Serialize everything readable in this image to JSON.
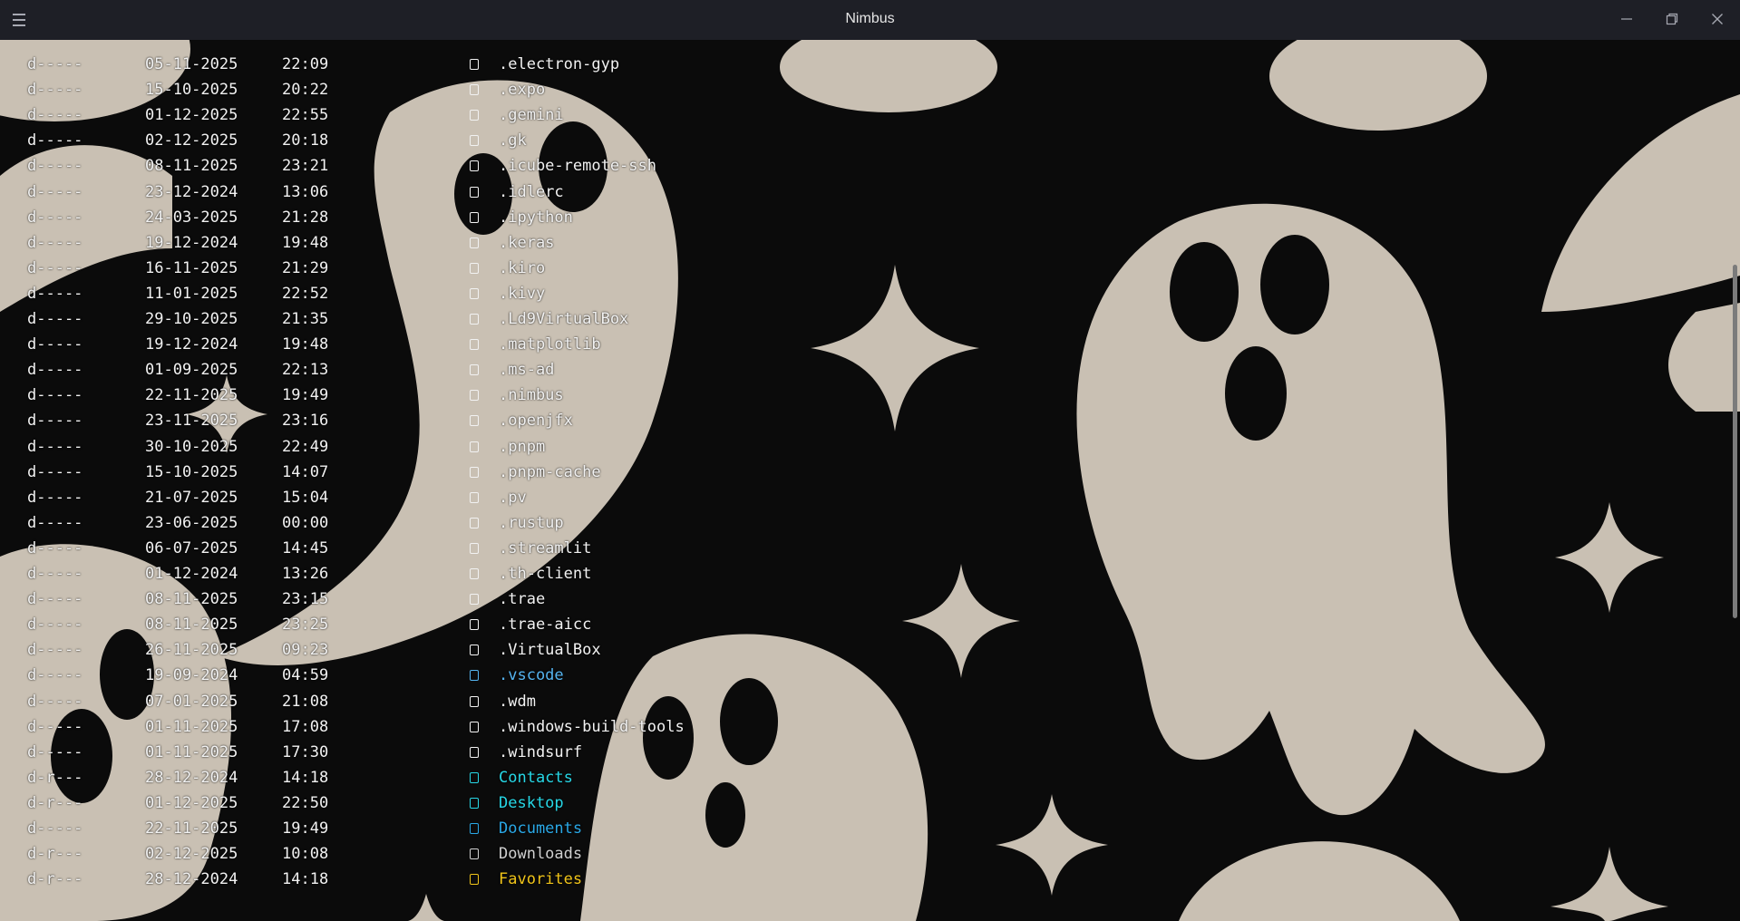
{
  "window": {
    "title": "Nimbus"
  },
  "colors": {
    "default": "#f2f2f2",
    "cyan": "#27d7e6",
    "blue": "#55b4f0",
    "docblue": "#2aa8e6",
    "gray": "#d0d0d0",
    "yellow": "#f0c419",
    "ghost": "#c9c0b3",
    "background": "#0b0b0b"
  },
  "entries": [
    {
      "mode": "d-----",
      "date": "05-11-2025",
      "time": "22:09",
      "name": ".electron-gyp",
      "color": "default"
    },
    {
      "mode": "d-----",
      "date": "15-10-2025",
      "time": "20:22",
      "name": ".expo",
      "color": "default"
    },
    {
      "mode": "d-----",
      "date": "01-12-2025",
      "time": "22:55",
      "name": ".gemini",
      "color": "default"
    },
    {
      "mode": "d-----",
      "date": "02-12-2025",
      "time": "20:18",
      "name": ".gk",
      "color": "default"
    },
    {
      "mode": "d-----",
      "date": "08-11-2025",
      "time": "23:21",
      "name": ".icube-remote-ssh",
      "color": "default"
    },
    {
      "mode": "d-----",
      "date": "23-12-2024",
      "time": "13:06",
      "name": ".idlerc",
      "color": "default"
    },
    {
      "mode": "d-----",
      "date": "24-03-2025",
      "time": "21:28",
      "name": ".ipython",
      "color": "default"
    },
    {
      "mode": "d-----",
      "date": "19-12-2024",
      "time": "19:48",
      "name": ".keras",
      "color": "default"
    },
    {
      "mode": "d-----",
      "date": "16-11-2025",
      "time": "21:29",
      "name": ".kiro",
      "color": "default"
    },
    {
      "mode": "d-----",
      "date": "11-01-2025",
      "time": "22:52",
      "name": ".kivy",
      "color": "default"
    },
    {
      "mode": "d-----",
      "date": "29-10-2025",
      "time": "21:35",
      "name": ".Ld9VirtualBox",
      "color": "default"
    },
    {
      "mode": "d-----",
      "date": "19-12-2024",
      "time": "19:48",
      "name": ".matplotlib",
      "color": "default"
    },
    {
      "mode": "d-----",
      "date": "01-09-2025",
      "time": "22:13",
      "name": ".ms-ad",
      "color": "default"
    },
    {
      "mode": "d-----",
      "date": "22-11-2025",
      "time": "19:49",
      "name": ".nimbus",
      "color": "default"
    },
    {
      "mode": "d-----",
      "date": "23-11-2025",
      "time": "23:16",
      "name": ".openjfx",
      "color": "default"
    },
    {
      "mode": "d-----",
      "date": "30-10-2025",
      "time": "22:49",
      "name": ".pnpm",
      "color": "default"
    },
    {
      "mode": "d-----",
      "date": "15-10-2025",
      "time": "14:07",
      "name": ".pnpm-cache",
      "color": "default"
    },
    {
      "mode": "d-----",
      "date": "21-07-2025",
      "time": "15:04",
      "name": ".pv",
      "color": "default"
    },
    {
      "mode": "d-----",
      "date": "23-06-2025",
      "time": "00:00",
      "name": ".rustup",
      "color": "default"
    },
    {
      "mode": "d-----",
      "date": "06-07-2025",
      "time": "14:45",
      "name": ".streamlit",
      "color": "default"
    },
    {
      "mode": "d-----",
      "date": "01-12-2024",
      "time": "13:26",
      "name": ".th-client",
      "color": "default"
    },
    {
      "mode": "d-----",
      "date": "08-11-2025",
      "time": "23:15",
      "name": ".trae",
      "color": "default"
    },
    {
      "mode": "d-----",
      "date": "08-11-2025",
      "time": "23:25",
      "name": ".trae-aicc",
      "color": "default"
    },
    {
      "mode": "d-----",
      "date": "26-11-2025",
      "time": "09:23",
      "name": ".VirtualBox",
      "color": "default"
    },
    {
      "mode": "d-----",
      "date": "19-09-2024",
      "time": "04:59",
      "name": ".vscode",
      "color": "blue"
    },
    {
      "mode": "d-----",
      "date": "07-01-2025",
      "time": "21:08",
      "name": ".wdm",
      "color": "default"
    },
    {
      "mode": "d-----",
      "date": "01-11-2025",
      "time": "17:08",
      "name": ".windows-build-tools",
      "color": "default"
    },
    {
      "mode": "d-----",
      "date": "01-11-2025",
      "time": "17:30",
      "name": ".windsurf",
      "color": "default"
    },
    {
      "mode": "d-r---",
      "date": "28-12-2024",
      "time": "14:18",
      "name": "Contacts",
      "color": "cyan"
    },
    {
      "mode": "d-r---",
      "date": "01-12-2025",
      "time": "22:50",
      "name": "Desktop",
      "color": "cyan"
    },
    {
      "mode": "d-----",
      "date": "22-11-2025",
      "time": "19:49",
      "name": "Documents",
      "color": "docblue"
    },
    {
      "mode": "d-r---",
      "date": "02-12-2025",
      "time": "10:08",
      "name": "Downloads",
      "color": "gray"
    },
    {
      "mode": "d-r---",
      "date": "28-12-2024",
      "time": "14:18",
      "name": "Favorites",
      "color": "yellow"
    }
  ]
}
